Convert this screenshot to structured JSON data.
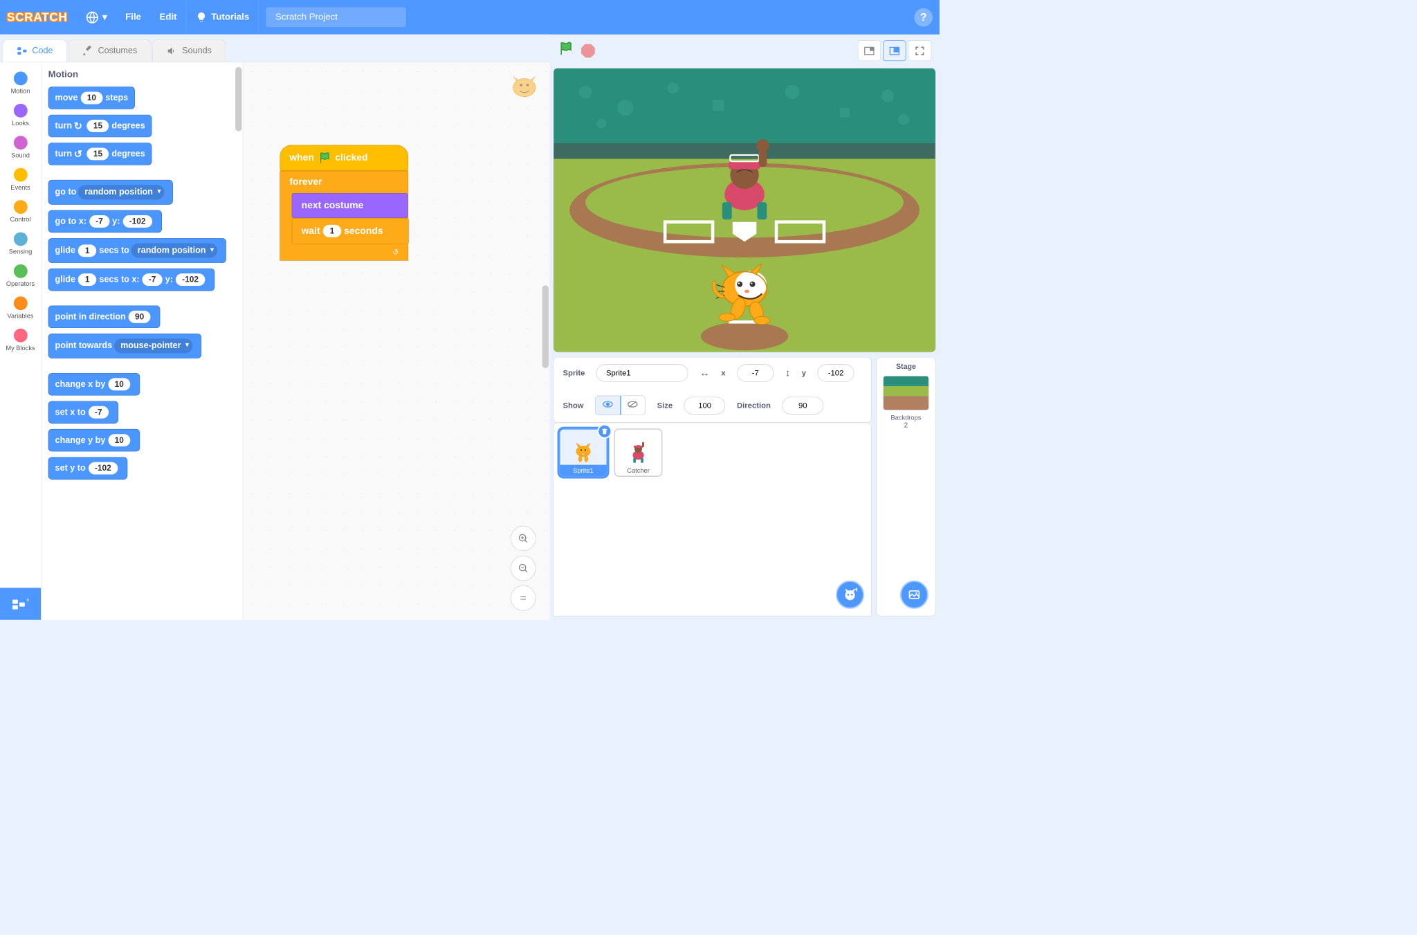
{
  "menubar": {
    "logo": "SCRATCH",
    "file": "File",
    "edit": "Edit",
    "tutorials": "Tutorials",
    "project_title": "Scratch Project",
    "help": "?"
  },
  "tabs": {
    "code": "Code",
    "costumes": "Costumes",
    "sounds": "Sounds"
  },
  "categories": [
    {
      "name": "Motion",
      "color": "#4c97ff"
    },
    {
      "name": "Looks",
      "color": "#9966ff"
    },
    {
      "name": "Sound",
      "color": "#cf63cf"
    },
    {
      "name": "Events",
      "color": "#ffbf00"
    },
    {
      "name": "Control",
      "color": "#ffab19"
    },
    {
      "name": "Sensing",
      "color": "#5cb1d6"
    },
    {
      "name": "Operators",
      "color": "#59c059"
    },
    {
      "name": "Variables",
      "color": "#ff8c1a"
    },
    {
      "name": "My Blocks",
      "color": "#ff6680"
    }
  ],
  "palette": {
    "header": "Motion",
    "move": {
      "prefix": "move",
      "val": "10",
      "suffix": "steps"
    },
    "turn_cw": {
      "prefix": "turn",
      "icon": "↻",
      "val": "15",
      "suffix": "degrees"
    },
    "turn_ccw": {
      "prefix": "turn",
      "icon": "↺",
      "val": "15",
      "suffix": "degrees"
    },
    "goto": {
      "prefix": "go to",
      "dropdown": "random position"
    },
    "gotoxy": {
      "prefix": "go to x:",
      "x": "-7",
      "mid": "y:",
      "y": "-102"
    },
    "glide_rand": {
      "prefix": "glide",
      "secs": "1",
      "mid": "secs to",
      "dropdown": "random position"
    },
    "glide_xy": {
      "prefix": "glide",
      "secs": "1",
      "mid": "secs to x:",
      "x": "-7",
      "mid2": "y:",
      "y": "-102"
    },
    "point_dir": {
      "prefix": "point in direction",
      "val": "90"
    },
    "point_towards": {
      "prefix": "point towards",
      "dropdown": "mouse-pointer"
    },
    "change_x": {
      "prefix": "change x by",
      "val": "10"
    },
    "set_x": {
      "prefix": "set x to",
      "val": "-7"
    },
    "change_y": {
      "prefix": "change y by",
      "val": "10"
    },
    "set_y": {
      "prefix": "set y to",
      "val": "-102"
    }
  },
  "script": {
    "when_flag": {
      "prefix": "when",
      "suffix": "clicked"
    },
    "forever": "forever",
    "next_costume": "next costume",
    "wait": {
      "prefix": "wait",
      "val": "1",
      "suffix": "seconds"
    },
    "loop_arrow": "↻"
  },
  "sprite_info": {
    "sprite_label": "Sprite",
    "sprite_name": "Sprite1",
    "x_label": "x",
    "x_val": "-7",
    "y_label": "y",
    "y_val": "-102",
    "show_label": "Show",
    "size_label": "Size",
    "size_val": "100",
    "direction_label": "Direction",
    "direction_val": "90"
  },
  "sprite_list": {
    "sprite1": "Sprite1",
    "catcher": "Catcher"
  },
  "stage_selector": {
    "label": "Stage",
    "backdrops_label": "Backdrops",
    "count": "2"
  },
  "zoom": {
    "in": "+",
    "out": "−",
    "reset": "="
  }
}
